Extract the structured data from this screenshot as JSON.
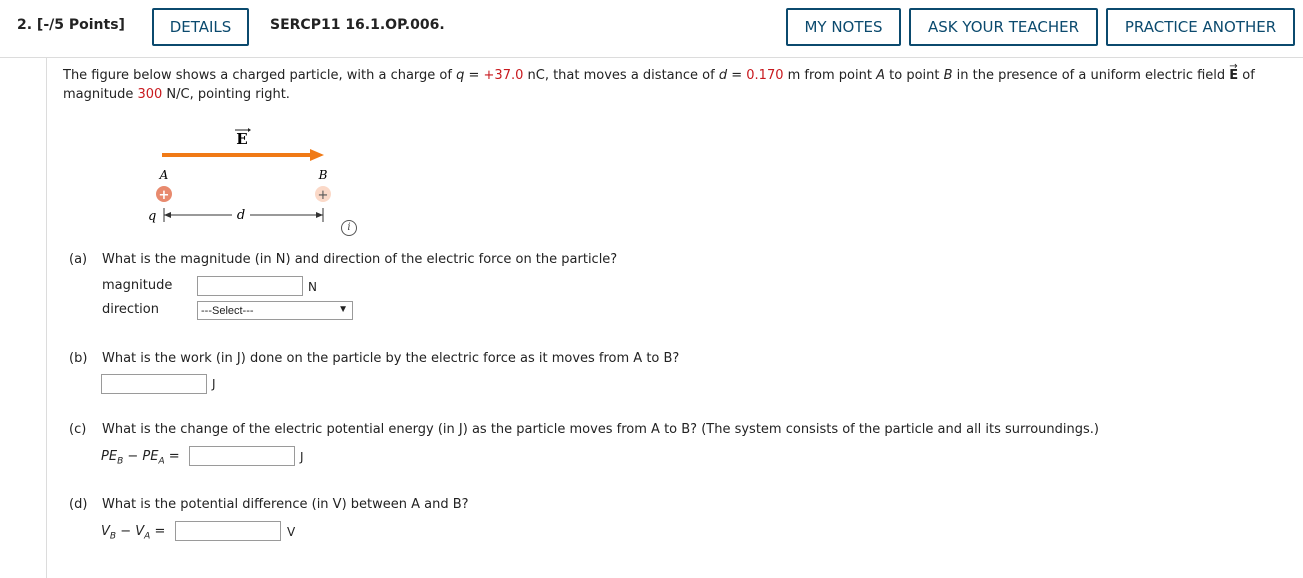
{
  "header": {
    "question_label": "2.  [-/5 Points]",
    "details_label": "DETAILS",
    "problem_code": "SERCP11 16.1.OP.006.",
    "my_notes_label": "MY NOTES",
    "ask_teacher_label": "ASK YOUR TEACHER",
    "practice_label": "PRACTICE ANOTHER",
    "accent_color": "#0b4a6e"
  },
  "statement": {
    "t1": "The figure below shows a charged particle, with a charge of ",
    "q_sym": "q",
    "eq1": " = ",
    "q_val": "+37.0",
    "t2": " nC, that moves a distance of ",
    "d_sym": "d",
    "eq2": " = ",
    "d_val": "0.170",
    "t3": " m from point ",
    "a": "A",
    "t4": " to point ",
    "b": "B",
    "t5": " in the presence of a uniform electric field ",
    "e_sym": "E",
    "t6": " of magnitude ",
    "mag_val": "300",
    "t7": " N/C, pointing right.",
    "value_color": "#c8191e"
  },
  "figure": {
    "field_label": "E",
    "point_a": "A",
    "point_b": "B",
    "charge_symbol": "q",
    "distance_symbol": "d",
    "plus": "+",
    "arrow_color": "#f07a16",
    "info_icon": "i"
  },
  "parts": {
    "a": {
      "label": "(a)",
      "question": "What is the magnitude (in N) and direction of the electric force on the particle?",
      "magnitude_label": "magnitude",
      "magnitude_value": "",
      "magnitude_unit": "N",
      "direction_label": "direction",
      "direction_selected": "---Select---"
    },
    "b": {
      "label": "(b)",
      "question": "What is the work (in J) done on the particle by the electric force as it moves from A to B?",
      "value": "",
      "unit": "J"
    },
    "c": {
      "label": "(c)",
      "question": "What is the change of the electric potential energy (in J) as the particle moves from A to B? (The system consists of the particle and all its surroundings.)",
      "lhs_pe": "PE",
      "sub_b": "B",
      "minus": " − ",
      "sub_a": "A",
      "equals": " =",
      "value": "",
      "unit": "J"
    },
    "d": {
      "label": "(d)",
      "question": "What is the potential difference (in V) between A and B?",
      "lhs_v": "V",
      "sub_b": "B",
      "minus": " − ",
      "sub_a": "A",
      "equals": " =",
      "value": "",
      "unit": "V"
    }
  }
}
